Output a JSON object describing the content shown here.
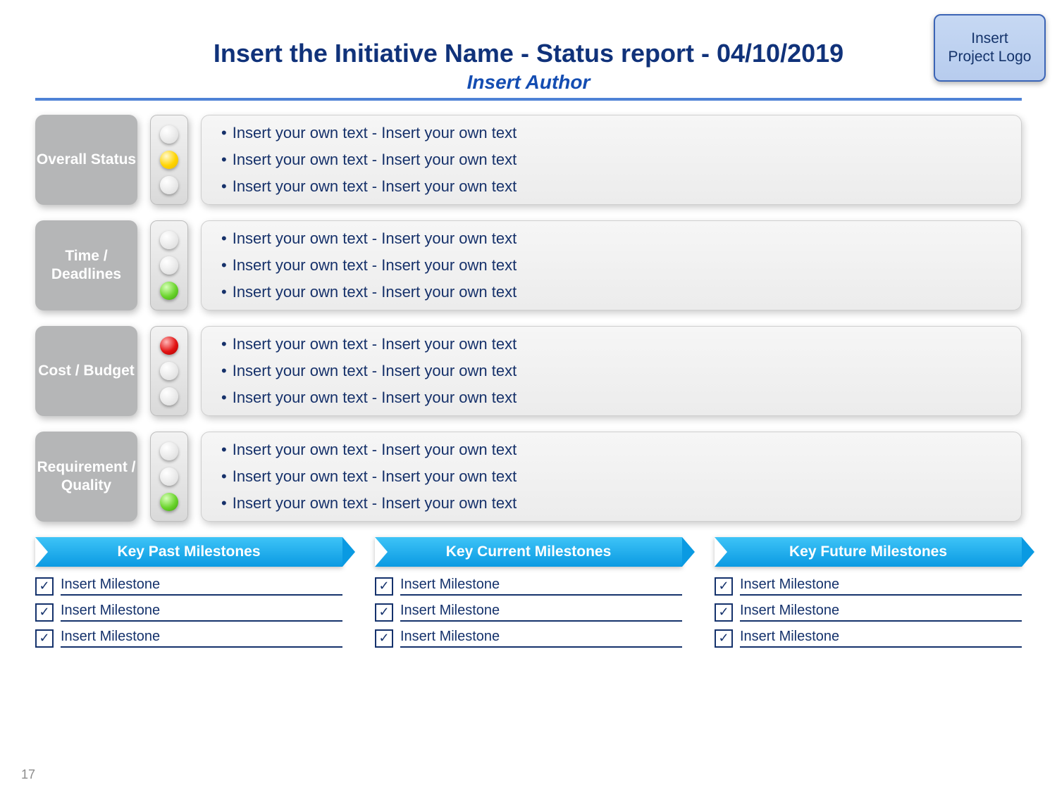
{
  "header": {
    "title": "Insert the Initiative Name - Status report - 04/10/2019",
    "author": "Insert Author",
    "logo_line1": "Insert",
    "logo_line2": "Project Logo"
  },
  "rows": [
    {
      "label": "Overall Status",
      "lights": [
        "off",
        "yellow",
        "off"
      ],
      "bullets": [
        "Insert your own text - Insert your own text",
        "Insert your own text - Insert your own text",
        "Insert your own text - Insert your own text"
      ]
    },
    {
      "label": "Time / Deadlines",
      "lights": [
        "off",
        "off",
        "green"
      ],
      "bullets": [
        "Insert your own text - Insert your own text",
        "Insert your own text - Insert your own text",
        "Insert your own text - Insert your own text"
      ]
    },
    {
      "label": "Cost / Budget",
      "lights": [
        "red",
        "off",
        "off"
      ],
      "bullets": [
        "Insert your own text - Insert your own text",
        "Insert your own text - Insert your own text",
        "Insert your own text - Insert your own text"
      ]
    },
    {
      "label": "Requirement / Quality",
      "lights": [
        "off",
        "off",
        "green"
      ],
      "bullets": [
        "Insert your own text - Insert your own text",
        "Insert your own text - Insert your own text",
        "Insert your own text - Insert your own text"
      ]
    }
  ],
  "milestones": {
    "columns": [
      {
        "heading": "Key Past Milestones",
        "items": [
          "Insert Milestone",
          "Insert Milestone",
          "Insert Milestone"
        ]
      },
      {
        "heading": "Key Current Milestones",
        "items": [
          "Insert Milestone",
          "Insert Milestone",
          "Insert Milestone"
        ]
      },
      {
        "heading": "Key Future Milestones",
        "items": [
          "Insert Milestone",
          "Insert Milestone",
          "Insert Milestone"
        ]
      }
    ]
  },
  "page_number": "17",
  "colors": {
    "text": "#15326c",
    "accent": "#0a9ae2",
    "red": "#e21313",
    "yellow": "#ffd400",
    "green": "#6ad42c"
  }
}
